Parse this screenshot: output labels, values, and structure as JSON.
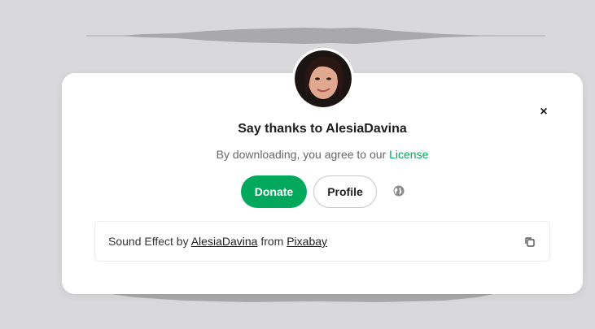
{
  "modal": {
    "title": "Say thanks to AlesiaDavina",
    "subtitle_prefix": "By downloading, you agree to our ",
    "license_link": "License",
    "close_symbol": "×",
    "donate_label": "Donate",
    "profile_label": "Profile",
    "globe_icon": "globe-icon"
  },
  "attribution": {
    "prefix": "Sound Effect by ",
    "author": "AlesiaDavina",
    "middle": " from ",
    "source": "Pixabay",
    "copy_icon": "copy-icon"
  },
  "colors": {
    "accent": "#02a95c",
    "background": "#d9d9db",
    "waveform": "#a9a9ab"
  }
}
